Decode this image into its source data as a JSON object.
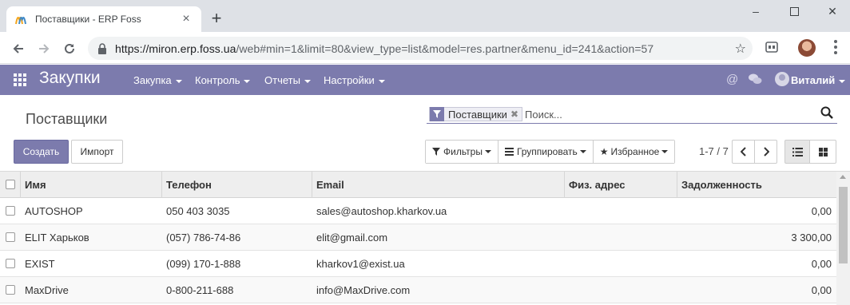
{
  "browser": {
    "tab_title": "Поставщики - ERP Foss",
    "tab_close": "×",
    "new_tab": "+",
    "url_domain": "https://miron.erp.foss.ua",
    "url_rest": "/web#min=1&limit=80&view_type=list&model=res.partner&menu_id=241&action=57",
    "minimize": "–",
    "close": "✕",
    "star": "☆"
  },
  "appbar": {
    "title": "Закупки",
    "menus": [
      {
        "label": "Закупка"
      },
      {
        "label": "Контроль"
      },
      {
        "label": "Отчеты"
      },
      {
        "label": "Настройки"
      }
    ],
    "user": "Виталий",
    "color": "#7c7bad"
  },
  "control_panel": {
    "breadcrumb": "Поставщики",
    "search": {
      "facet": "Поставщики",
      "placeholder": "Поиск..."
    },
    "create_label": "Создать",
    "import_label": "Импорт",
    "filters_label": "Фильтры",
    "group_label": "Группировать",
    "favorites_label": "Избранное",
    "pager": "1-7 / 7"
  },
  "table": {
    "columns": [
      "Имя",
      "Телефон",
      "Email",
      "Физ. адрес",
      "Задолженность"
    ],
    "rows": [
      {
        "name": "AUTOSHOP",
        "phone": "050 403 3035",
        "email": "sales@autoshop.kharkov.ua",
        "address": "",
        "debt": "0,00"
      },
      {
        "name": "ELIT Харьков",
        "phone": "(057) 786-74-86",
        "email": "elit@gmail.com",
        "address": "",
        "debt": "3 300,00"
      },
      {
        "name": "EXIST",
        "phone": "(099) 170-1-888",
        "email": "kharkov1@exist.ua",
        "address": "",
        "debt": "0,00"
      },
      {
        "name": "MaxDrive",
        "phone": "0-800-211-688",
        "email": "info@MaxDrive.com",
        "address": "",
        "debt": "0,00"
      }
    ]
  }
}
